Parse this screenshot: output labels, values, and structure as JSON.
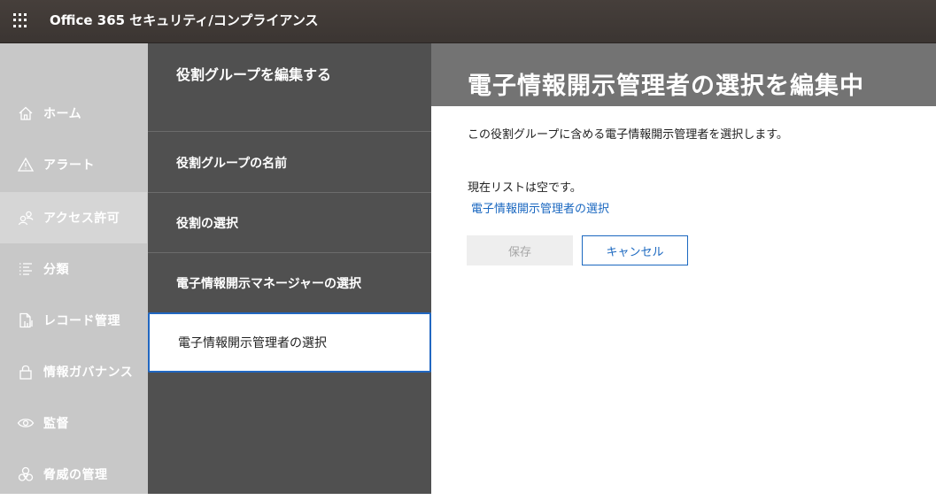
{
  "header": {
    "app_title": "Office 365 セキュリティ/コンプライアンス",
    "waffle_icon": "app-launcher-icon"
  },
  "nav": {
    "items": [
      {
        "label": "ホーム",
        "icon": "home-icon"
      },
      {
        "label": "アラート",
        "icon": "alert-icon"
      },
      {
        "label": "アクセス許可",
        "icon": "people-icon",
        "active": true
      },
      {
        "label": "分類",
        "icon": "list-icon"
      },
      {
        "label": "レコード管理",
        "icon": "records-icon"
      },
      {
        "label": "情報ガバナンス",
        "icon": "lock-icon"
      },
      {
        "label": "監督",
        "icon": "eye-icon"
      },
      {
        "label": "脅威の管理",
        "icon": "biohazard-icon"
      }
    ]
  },
  "wizard": {
    "title": "役割グループを編集する",
    "steps": [
      {
        "label": "役割グループの名前"
      },
      {
        "label": "役割の選択"
      },
      {
        "label": "電子情報開示マネージャーの選択"
      },
      {
        "label": "電子情報開示管理者の選択",
        "current": true
      }
    ]
  },
  "main": {
    "title": "電子情報開示管理者の選択を編集中",
    "description": "この役割グループに含める電子情報開示管理者を選択します。",
    "empty_text": "現在リストは空です。",
    "select_link": "電子情報開示管理者の選択",
    "save_label": "保存",
    "cancel_label": "キャンセル"
  },
  "colors": {
    "topbar": "#3f3936",
    "nav_bg": "#c8c8c8",
    "wizard_bg": "#505050",
    "accent": "#1b68c0"
  }
}
